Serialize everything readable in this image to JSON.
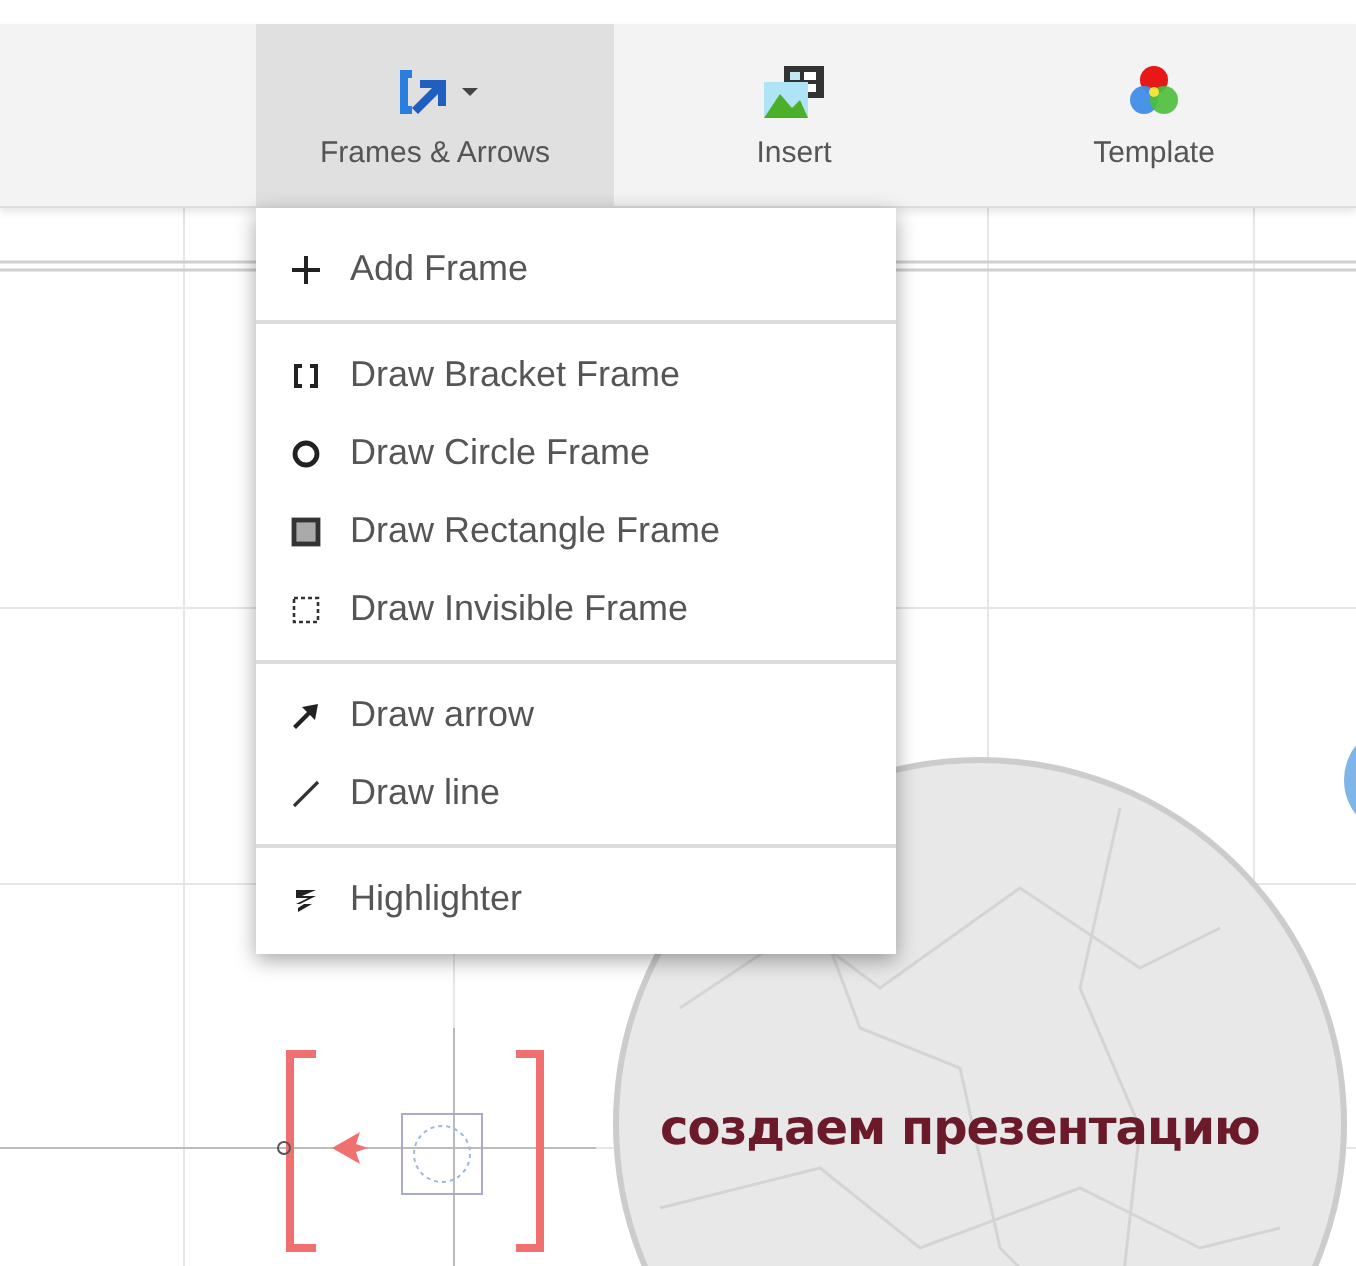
{
  "toolbar": [
    {
      "label": "Frames & Arrows",
      "kind": "frames",
      "selected": true,
      "dropdown": true
    },
    {
      "label": "Insert",
      "kind": "insert",
      "selected": false,
      "dropdown": false
    },
    {
      "label": "Template",
      "kind": "template",
      "selected": false,
      "dropdown": false
    }
  ],
  "menu": {
    "sections": [
      [
        {
          "label": "Add Frame",
          "kind": "plus"
        }
      ],
      [
        {
          "label": "Draw Bracket Frame",
          "kind": "bracket"
        },
        {
          "label": "Draw Circle Frame",
          "kind": "circle"
        },
        {
          "label": "Draw Rectangle Frame",
          "kind": "rectangle"
        },
        {
          "label": "Draw Invisible Frame",
          "kind": "invisible"
        }
      ],
      [
        {
          "label": "Draw arrow",
          "kind": "arrow"
        },
        {
          "label": "Draw line",
          "kind": "line"
        }
      ],
      [
        {
          "label": "Highlighter",
          "kind": "highlighter"
        }
      ]
    ]
  },
  "canvas": {
    "caption": "создаем презентацию"
  }
}
